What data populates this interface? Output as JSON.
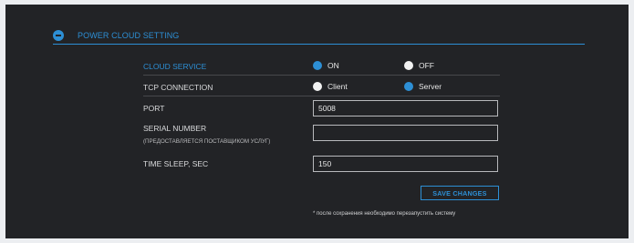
{
  "section": {
    "title": "POWER CLOUD SETTING"
  },
  "rows": {
    "cloud_service": {
      "label": "CLOUD SERVICE",
      "options": [
        {
          "label": "ON",
          "selected": true
        },
        {
          "label": "OFF",
          "selected": false
        }
      ]
    },
    "tcp_connection": {
      "label": "TCP CONNECTION",
      "options": [
        {
          "label": "Client",
          "selected": false
        },
        {
          "label": "Server",
          "selected": true
        }
      ]
    },
    "port": {
      "label": "PORT",
      "value": "5008"
    },
    "serial_number": {
      "label": "SERIAL NUMBER",
      "sublabel": "(ПРЕДОСТАВЛЯЕТСЯ ПОСТАВЩИКОМ УСЛУГ)",
      "value": ""
    },
    "time_sleep": {
      "label": "TIME SLEEP, SEC",
      "value": "150"
    }
  },
  "actions": {
    "save_label": "SAVE CHANGES"
  },
  "footnote": "* после сохранения необходимо перезапустить систему",
  "colors": {
    "accent": "#2d8fd5",
    "panel": "#222326",
    "page": "#eceef1"
  }
}
